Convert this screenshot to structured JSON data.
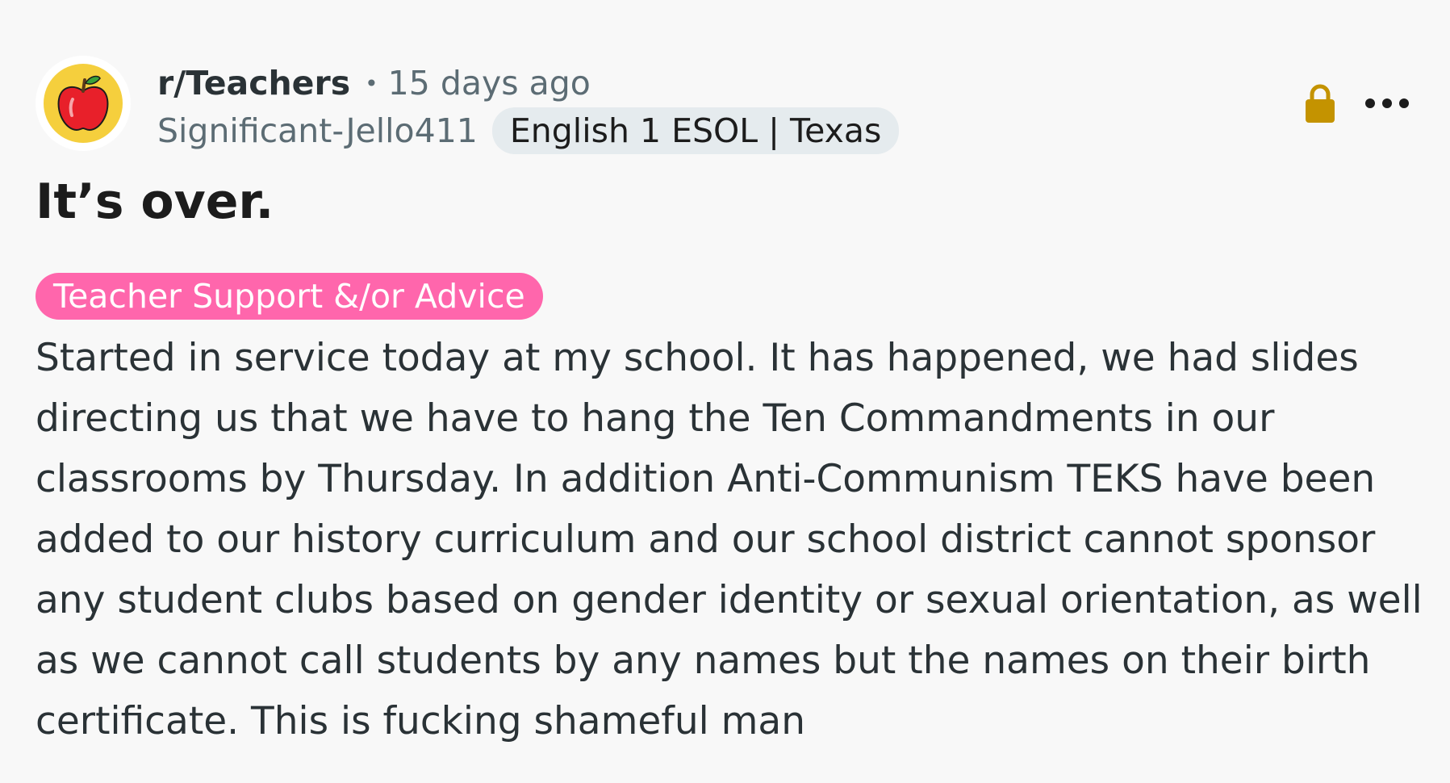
{
  "post": {
    "subreddit": "r/Teachers",
    "separator": "•",
    "time": "15 days ago",
    "author": "Significant-Jello411",
    "user_flair": "English 1 ESOL | Texas",
    "title": "It’s over.",
    "post_flair": "Teacher Support &/or Advice",
    "body": "Started in service today at my school. It has happened, we had slides directing us that we have to hang the Ten Commandments in our classrooms by Thursday. In addition Anti-Communism TEKS have been added to our history curriculum and our school district cannot sponsor any student clubs based on gender identity or sexual orientation, as well as we cannot call students by any names but the names on their birth certificate. This is fucking shameful man"
  },
  "icons": {
    "avatar": "apple-icon",
    "locked": "lock-icon",
    "menu": "more-options-icon"
  },
  "colors": {
    "background": "#f8f8f8",
    "avatar_bg": "#f5cf3d",
    "apple": "#e8202a",
    "lock": "#c49300",
    "post_flair_bg": "#ff66ac",
    "user_flair_bg": "#e5ebee"
  }
}
